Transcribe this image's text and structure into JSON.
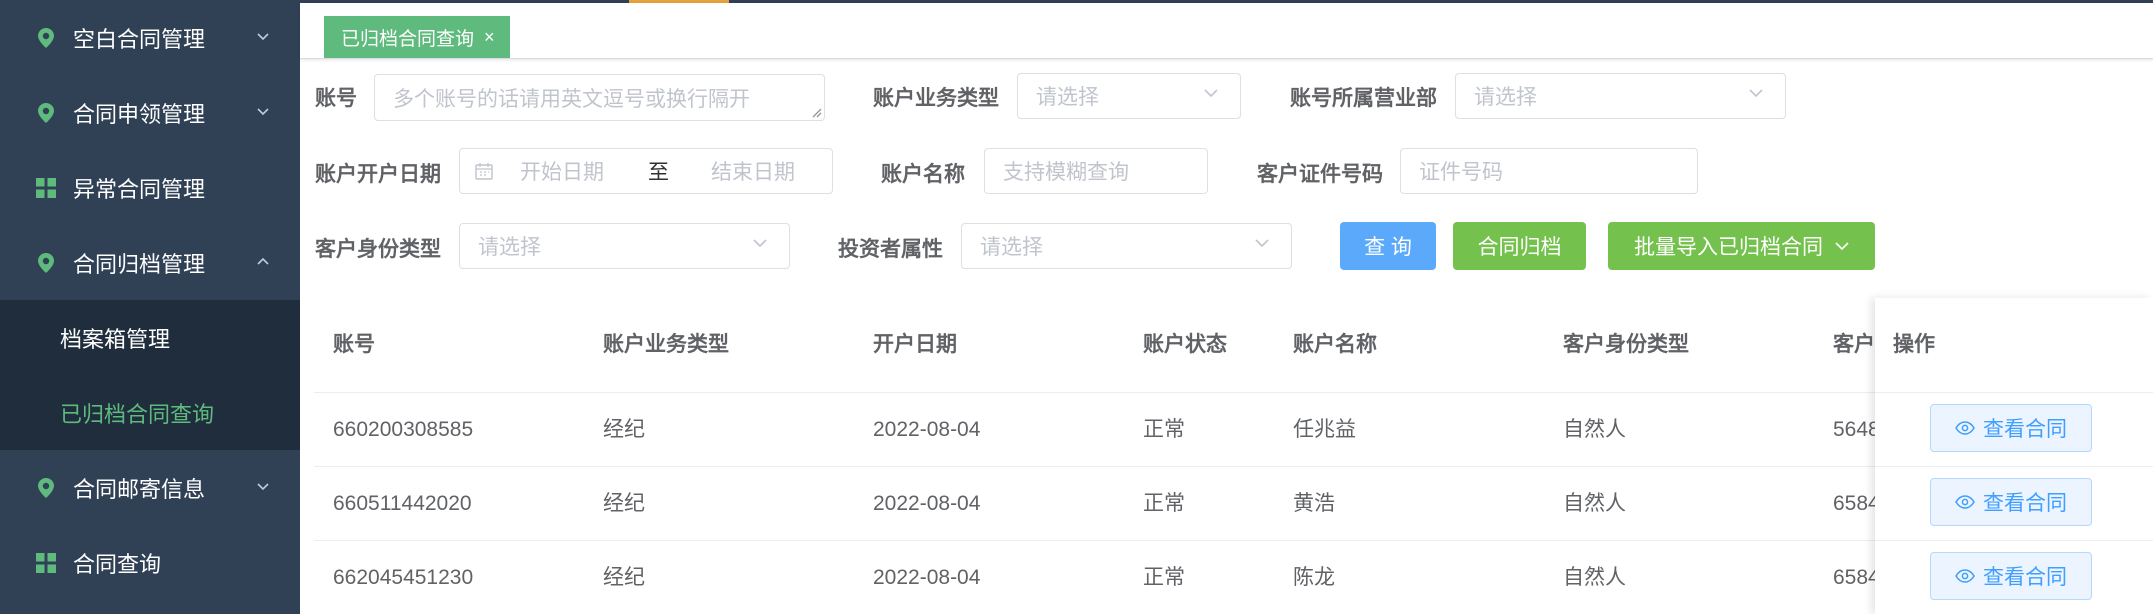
{
  "sidebar": {
    "items": [
      {
        "label": "空白合同管理",
        "icon": "location-pin-icon"
      },
      {
        "label": "合同申领管理",
        "icon": "location-pin-icon"
      },
      {
        "label": "异常合同管理",
        "icon": "grid-icon"
      },
      {
        "label": "合同归档管理",
        "icon": "location-pin-icon",
        "expanded": true
      },
      {
        "label": "合同邮寄信息",
        "icon": "location-pin-icon"
      },
      {
        "label": "合同查询",
        "icon": "grid-icon"
      }
    ],
    "subitems": [
      {
        "label": "档案箱管理"
      },
      {
        "label": "已归档合同查询",
        "active": true
      }
    ],
    "colors": {
      "bg": "#304156",
      "sub_bg": "#1f2d3d",
      "active": "#5fba7d"
    }
  },
  "tags": {
    "active_tag": "已归档合同查询",
    "close": "×"
  },
  "form": {
    "account": {
      "label": "账号",
      "placeholder": "多个账号的话请用英文逗号或换行隔开"
    },
    "business_type": {
      "label": "账户业务类型",
      "placeholder": "请选择"
    },
    "branch": {
      "label": "账号所属营业部",
      "placeholder": "请选择"
    },
    "open_date": {
      "label": "账户开户日期",
      "start_placeholder": "开始日期",
      "separator": "至",
      "end_placeholder": "结束日期"
    },
    "account_name": {
      "label": "账户名称",
      "placeholder": "支持模糊查询"
    },
    "id_number": {
      "label": "客户证件号码",
      "placeholder": "证件号码"
    },
    "identity_type": {
      "label": "客户身份类型",
      "placeholder": "请选择"
    },
    "investor": {
      "label": "投资者属性",
      "placeholder": "请选择"
    },
    "buttons": {
      "query": "查 询",
      "archive": "合同归档",
      "batch_import": "批量导入已归档合同"
    }
  },
  "table": {
    "headers": [
      "账号",
      "账户业务类型",
      "开户日期",
      "账户状态",
      "账户名称",
      "客户身份类型",
      "客户"
    ],
    "action_header": "操作",
    "action_label": "查看合同",
    "rows": [
      [
        "660200308585",
        "经纪",
        "2022-08-04",
        "正常",
        "任兆益",
        "自然人",
        "5648"
      ],
      [
        "660511442020",
        "经纪",
        "2022-08-04",
        "正常",
        "黄浩",
        "自然人",
        "6584"
      ],
      [
        "662045451230",
        "经纪",
        "2022-08-04",
        "正常",
        "陈龙",
        "自然人",
        "6584"
      ]
    ]
  },
  "colors": {
    "primary": "#409eff",
    "success": "#67c23a",
    "tag": "#5fba7d",
    "accent_top": "#e6a23c"
  }
}
